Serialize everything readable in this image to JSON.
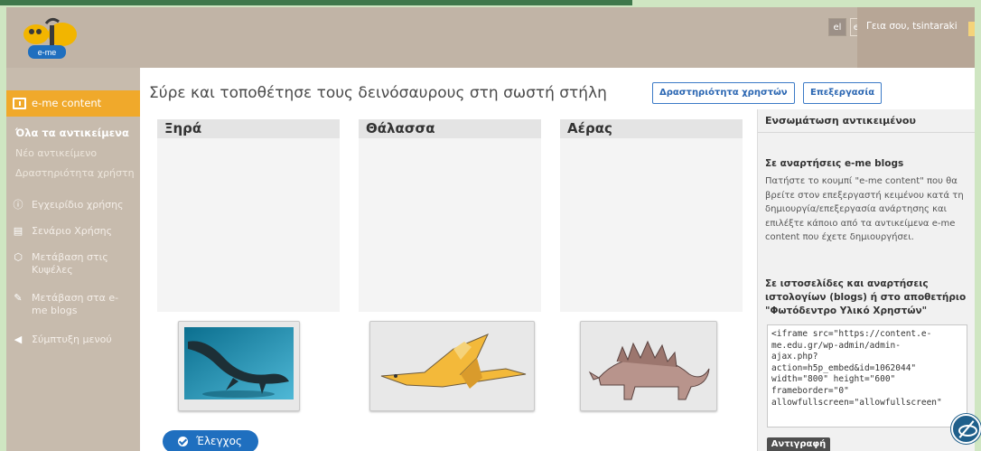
{
  "header": {
    "logo_text": "e-me",
    "lang_el": "el",
    "lang_en": "en",
    "greeting": "Γεια σου, tsintaraki"
  },
  "sidebar": {
    "active_label": "e-me content",
    "items": [
      {
        "label": "Όλα τα αντικείμενα"
      },
      {
        "label": "Νέο αντικείμενο"
      },
      {
        "label": "Δραστηριότητα χρήστη"
      },
      {
        "label": "Εγχειρίδιο χρήσης"
      },
      {
        "label": "Σενάριο Χρήσης"
      },
      {
        "label": "Μετάβαση στις Κυψέλες"
      },
      {
        "label": "Μετάβαση στα e-me blogs"
      },
      {
        "label": "Σύμπτυξη μενού"
      }
    ]
  },
  "main": {
    "title": "Σύρε και τοποθέτησε τους δεινόσαυρους στη σωστή στήλη",
    "users_activity_button": "Δραστηριότητα χρηστών",
    "edit_button": "Επεξεργασία",
    "columns": [
      "Ξηρά",
      "Θάλασσα",
      "Αέρας"
    ],
    "check_button": "Έλεγχος"
  },
  "panel": {
    "title": "Ενσωμάτωση αντικειμένου",
    "blogs_heading": "Σε αναρτήσεις e-me blogs",
    "blogs_text": "Πατήστε το κουμπί \"e-me content\" που θα βρείτε στον επεξεργαστή κειμένου κατά τη δημιουργία/επεξεργασία ανάρτησης και επιλέξτε κάποιο από τα αντικείμενα e-me content που έχετε δημιουργήσει.",
    "sites_heading": "Σε ιστοσελίδες και αναρτήσεις ιστολογίων (blogs) ή στο αποθετήριο \"Φωτόδεντρο Υλικό Χρηστών\"",
    "embed_code": "<iframe src=\"https://content.e-\nme.edu.gr/wp-admin/admin-\najax.php?\naction=h5p_embed&id=1062044\"\nwidth=\"800\" height=\"600\"\nframeborder=\"0\"\nallowfullscreen=\"allowfullscreen\"",
    "copy_button": "Αντιγραφή"
  },
  "colors": {
    "header_bg": "#c1b4a6",
    "sidebar_bg": "#c7bbad",
    "accent_orange": "#f0a92b",
    "link_blue": "#2a66b2",
    "check_blue": "#1f6fbf"
  },
  "icons": {
    "content": "content-icon",
    "manual": "info-icon",
    "scenario": "document-icon",
    "hives": "hexagon-icon",
    "blogs": "pencil-icon",
    "collapse": "chevron-left-icon",
    "accessibility": "eye-slash-icon"
  }
}
